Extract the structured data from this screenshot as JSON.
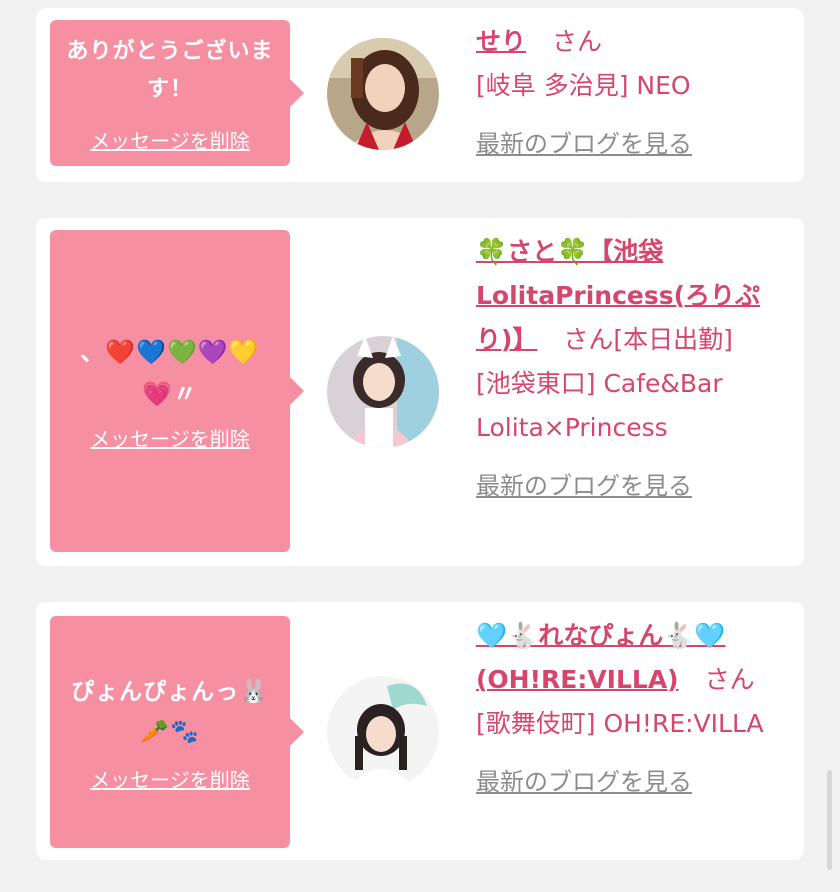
{
  "cards": [
    {
      "message": "ありがとうございます！",
      "delete_label": "メッセージを削除",
      "name": "せり",
      "suffix": "さん",
      "shop": "[岐阜 多治見] NEO",
      "blog_label": "最新のブログを見る",
      "avatar": "cast-photo-seri"
    },
    {
      "message": "、❤️💙💚💜💛💗〃",
      "delete_label": "メッセージを削除",
      "name": "🍀さと🍀【池袋LolitaPrincess(ろりぷり)】",
      "suffix": "さん[本日出勤]",
      "shop": "[池袋東口] Cafe&Bar Lolita×Princess",
      "blog_label": "最新のブログを見る",
      "avatar": "cast-photo-sato"
    },
    {
      "message": "ぴょんぴょんっ🐰🥕🐾",
      "delete_label": "メッセージを削除",
      "name": "🩵🐇れなぴょん🐇🩵(OH!RE:VILLA)",
      "suffix": "さん",
      "shop": "[歌舞伎町] OH!RE:VILLA",
      "blog_label": "最新のブログを見る",
      "avatar": "cast-photo-renapyon"
    }
  ],
  "colors": {
    "bubble": "#f68fa2",
    "accent": "#d6456c",
    "muted": "#8c8c8c",
    "background": "#f1f1f1"
  }
}
